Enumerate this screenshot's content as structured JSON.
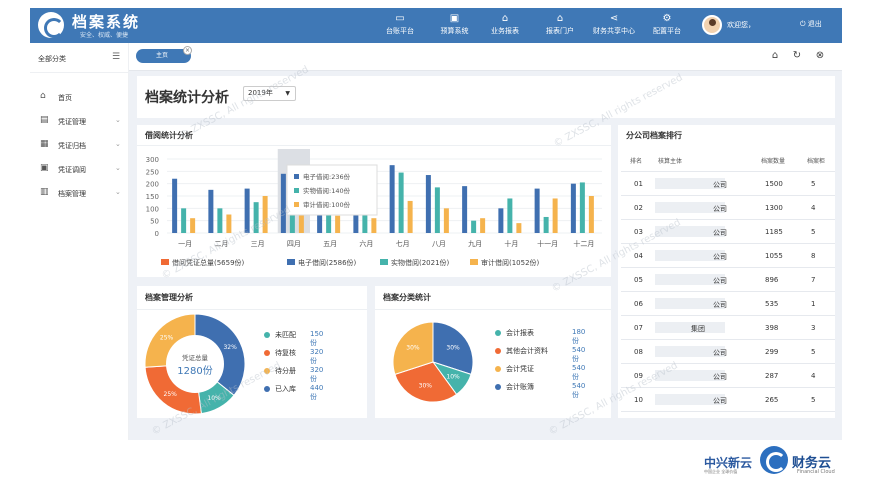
{
  "header": {
    "title": "档案系统",
    "slogan": "安全、权威、便捷",
    "nav": [
      "台账平台",
      "预算系统",
      "业务报表",
      "报表门户",
      "财务共享中心",
      "配置平台"
    ],
    "welcome": "欢迎您，",
    "logout": "退出"
  },
  "sidebar": {
    "title": "全部分类",
    "items": [
      "首页",
      "凭证管理",
      "凭证归档",
      "凭证调阅",
      "档案管理"
    ]
  },
  "tabs": {
    "home": "主页"
  },
  "page": {
    "title": "档案统计分析",
    "year": "2019年"
  },
  "borrow": {
    "title": "借阅统计分析",
    "tooltip": [
      "电子借阅:236份",
      "实物借阅:140份",
      "审计借阅:100份"
    ],
    "legend": [
      "借阅凭证总量(5659份)",
      "电子借阅(2586份)",
      "实物借阅(2021份)",
      "审计借阅(1052份)"
    ]
  },
  "chart_data": [
    {
      "type": "bar",
      "title": "借阅统计分析",
      "categories": [
        "一月",
        "二月",
        "三月",
        "四月",
        "五月",
        "六月",
        "七月",
        "八月",
        "九月",
        "十月",
        "十一月",
        "十二月"
      ],
      "ylim": [
        0,
        300
      ],
      "yticks": [
        0,
        50,
        100,
        150,
        200,
        250,
        300
      ],
      "series": [
        {
          "name": "电子借阅(2586份)",
          "color": "#3f6fb0",
          "values": [
            220,
            175,
            180,
            240,
            195,
            195,
            275,
            235,
            190,
            100,
            180,
            200
          ]
        },
        {
          "name": "实物借阅(2021份)",
          "color": "#45b3ab",
          "values": [
            100,
            100,
            125,
            140,
            75,
            75,
            245,
            185,
            50,
            140,
            65,
            205
          ]
        },
        {
          "name": "审计借阅(1052份)",
          "color": "#f5b34d",
          "values": [
            60,
            75,
            150,
            100,
            70,
            60,
            130,
            100,
            60,
            40,
            140,
            150
          ]
        }
      ]
    },
    {
      "type": "pie",
      "title": "档案管理分析",
      "center_label": "凭证总量",
      "center_value": "1280份",
      "slices": [
        {
          "name": "未匹配",
          "value": 150,
          "label": "150份",
          "color": "#45b3ab",
          "pct": "10%"
        },
        {
          "name": "待复核",
          "value": 320,
          "label": "320份",
          "color": "#f06a35",
          "pct": "25%"
        },
        {
          "name": "待分册",
          "value": 320,
          "label": "320份",
          "color": "#f5b34d",
          "pct": "25%"
        },
        {
          "name": "已入库",
          "value": 440,
          "label": "440份",
          "color": "#3f6fb0",
          "pct": "32%"
        }
      ]
    },
    {
      "type": "pie",
      "title": "档案分类统计",
      "slices": [
        {
          "name": "会计报表",
          "value": 180,
          "label": "180份",
          "color": "#45b3ab",
          "pct": "10%"
        },
        {
          "name": "其他会计资料",
          "value": 540,
          "label": "540份",
          "color": "#f06a35",
          "pct": "30%"
        },
        {
          "name": "会计凭证",
          "value": 540,
          "label": "540份",
          "color": "#f5b34d",
          "pct": "30%"
        },
        {
          "name": "会计账簿",
          "value": 540,
          "label": "540份",
          "color": "#3f6fb0",
          "pct": "30%"
        }
      ]
    },
    {
      "type": "table",
      "title": "分公司档案排行",
      "columns": [
        "排名",
        "核算主体",
        "档案数量",
        "档案柜"
      ],
      "rows": [
        [
          "01",
          "公司",
          "1500",
          "5"
        ],
        [
          "02",
          "公司",
          "1300",
          "4"
        ],
        [
          "03",
          "公司",
          "1185",
          "5"
        ],
        [
          "04",
          "公司",
          "1055",
          "8"
        ],
        [
          "05",
          "公司",
          "896",
          "7"
        ],
        [
          "06",
          "公司",
          "535",
          "1"
        ],
        [
          "07",
          "集团",
          "398",
          "3"
        ],
        [
          "08",
          "公司",
          "299",
          "5"
        ],
        [
          "09",
          "公司",
          "287",
          "4"
        ],
        [
          "10",
          "公司",
          "265",
          "5"
        ]
      ]
    }
  ],
  "watermark": "© ZXSSC, All rights reserved",
  "footer": {
    "brand_left": "中兴新云",
    "brand_right": "财务云",
    "tag_left": "中国企业 全球价值",
    "tag_right": "Financial Cloud"
  },
  "colors": {
    "primary": "#3f78b6",
    "blue": "#3f6fb0",
    "teal": "#45b3ab",
    "orange": "#f06a35",
    "gold": "#f5b34d"
  }
}
